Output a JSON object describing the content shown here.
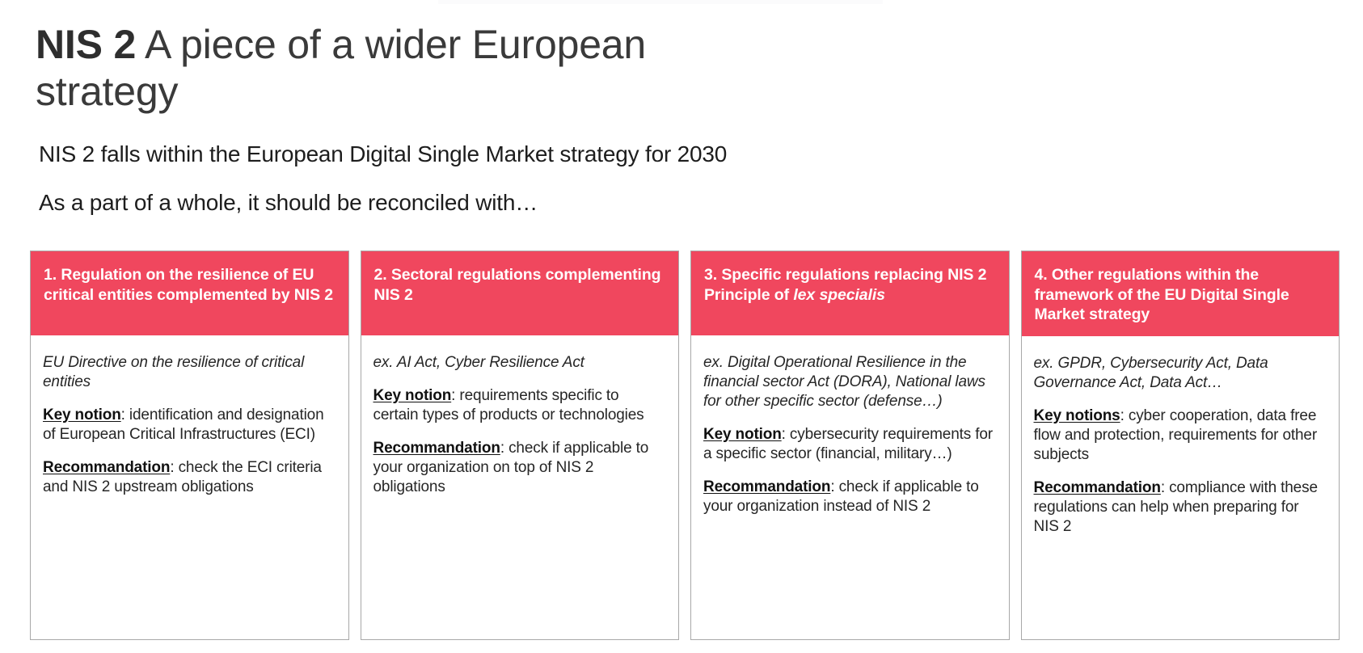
{
  "slide": {
    "title_strong": "NIS 2",
    "title_rest": " A piece of a wider European strategy",
    "subline_1": "NIS 2 falls within the European Digital Single Market strategy for 2030",
    "subline_2": "As a part of a whole, it should be reconciled with…"
  },
  "colors": {
    "accent_pink": "#f0475e",
    "title_gray": "#3a3a3a",
    "body_text": "#262626",
    "card_border": "#a8a8a8"
  },
  "cards": [
    {
      "header_title": "1. Regulation on the resilience of EU critical entities complemented by NIS 2",
      "header_sub": "",
      "header_sub_italic": "",
      "example": "EU Directive on the resilience of critical entities",
      "key_label": "Key notion",
      "key_text": ": identification and designation of European Critical Infrastructures (ECI)",
      "reco_label": "Recommandation",
      "reco_text": ": check the ECI criteria and NIS 2 upstream obligations"
    },
    {
      "header_title": "2. Sectoral regulations complementing NIS 2",
      "header_sub": "",
      "header_sub_italic": "",
      "example": "ex. AI Act, Cyber Resilience Act",
      "key_label": "Key notion",
      "key_text": ": requirements specific to certain types of products or technologies",
      "reco_label": "Recommandation",
      "reco_text": ": check if applicable to your organization on top of NIS 2 obligations"
    },
    {
      "header_title": "3. Specific regulations replacing NIS 2",
      "header_sub": "Principle of ",
      "header_sub_italic": "lex specialis",
      "example": "ex. Digital Operational Resilience in the financial sector Act (DORA), National laws for other specific sector (defense…)",
      "key_label": "Key notion",
      "key_text": ": cybersecurity requirements for a specific sector (financial, military…)",
      "reco_label": "Recommandation",
      "reco_text": ": check if applicable to your organization instead of NIS 2"
    },
    {
      "header_title": "4. Other regulations within the framework of the EU Digital Single Market strategy",
      "header_sub": "",
      "header_sub_italic": "",
      "example": "ex. GPDR, Cybersecurity Act, Data Governance Act, Data Act…",
      "key_label": "Key notions",
      "key_text": ": cyber cooperation, data free flow and protection, requirements for other subjects",
      "reco_label": "Recommandation",
      "reco_text": ": compliance with these regulations can help when preparing for NIS 2"
    }
  ]
}
